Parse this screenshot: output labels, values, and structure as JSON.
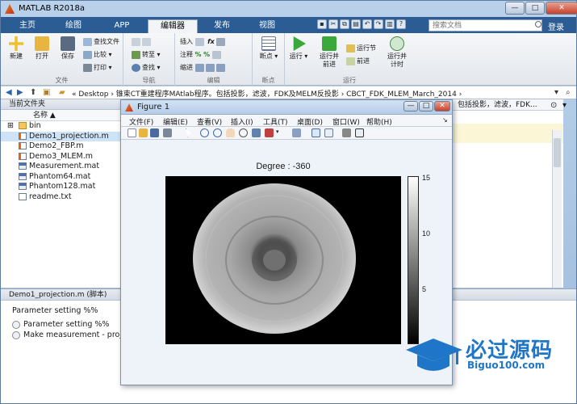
{
  "window": {
    "title": "MATLAB R2018a",
    "min": "—",
    "max": "□",
    "close": "✕"
  },
  "tabs": [
    {
      "label": "主页"
    },
    {
      "label": "绘图"
    },
    {
      "label": "APP"
    },
    {
      "label": "编辑器"
    },
    {
      "label": "发布"
    },
    {
      "label": "视图"
    }
  ],
  "search": {
    "placeholder": "搜索文档"
  },
  "login_label": "登录",
  "ribbon": {
    "file": {
      "new": "新建",
      "open": "打开",
      "save": "保存",
      "find_files": "查找文件",
      "compare": "比较",
      "print": "打印",
      "group": "文件"
    },
    "navigate": {
      "goto": "转至",
      "find": "查找",
      "group": "导航"
    },
    "edit": {
      "insert": "插入",
      "comment": "注释",
      "indent": "缩进",
      "group": "编辑"
    },
    "breakpoints": {
      "bp": "断点",
      "group": "断点"
    },
    "run": {
      "run": "运行",
      "run_advance_1": "运行并",
      "run_advance_2": "前进",
      "run_section": "运行节",
      "advance": "前进",
      "run_time_1": "运行并",
      "run_time_2": "计时",
      "group": "运行"
    }
  },
  "address": {
    "path": "« Desktop › 锥束CT重建程序MAtlab程序。包括投影，滤波，FDK及MELM反投影 › CBCT_FDK_MLEM_March_2014 ›"
  },
  "folder_panel": {
    "title": "当前文件夹",
    "column": "名称 ▲",
    "files": [
      {
        "name": "bin",
        "type": "folder"
      },
      {
        "name": "Demo1_projection.m",
        "type": "m"
      },
      {
        "name": "Demo2_FBP.m",
        "type": "m"
      },
      {
        "name": "Demo3_MLEM.m",
        "type": "m"
      },
      {
        "name": "Measurement.mat",
        "type": "mat"
      },
      {
        "name": "Phantom64.mat",
        "type": "mat"
      },
      {
        "name": "Phantom128.mat",
        "type": "mat"
      },
      {
        "name": "readme.txt",
        "type": "txt"
      }
    ]
  },
  "right_panel": {
    "header_text": "包括投影，滤波，FDK..."
  },
  "details": {
    "title": "Demo1_projection.m (脚本)",
    "heading": "Parameter setting %%",
    "items": [
      "Parameter setting %%",
      "Make measurement - proje"
    ]
  },
  "figure": {
    "title": "Figure 1",
    "menu": [
      "文件(F)",
      "编辑(E)",
      "查看(V)",
      "插入(I)",
      "工具(T)",
      "桌面(D)",
      "窗口(W)",
      "帮助(H)"
    ],
    "plot_title": "Degree : -360",
    "colorbar_ticks": [
      "15",
      "10",
      "5"
    ]
  },
  "watermark": {
    "line1": "必过源码",
    "line2": "Biguo100.com"
  }
}
